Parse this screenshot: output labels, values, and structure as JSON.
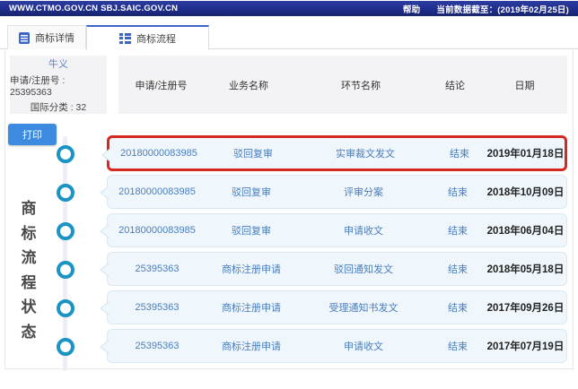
{
  "topbar": {
    "site": "WWW.CTMO.GOV.CN SBJ.SAIC.GOV.CN",
    "help": "帮助",
    "data_cutoff": "当前数据截至：(2019年02月25日)"
  },
  "tabs": [
    {
      "label": "商标详情",
      "active": false
    },
    {
      "label": "商标流程",
      "active": true
    }
  ],
  "info": {
    "name": "牛义",
    "reg_no": "申请/注册号 : 25395363",
    "intl_class": "国际分类 : 32"
  },
  "print_button": "打印",
  "vertical_title": "商标流程状态",
  "table": {
    "headers": [
      "申请/注册号",
      "业务名称",
      "环节名称",
      "结论",
      "日期"
    ],
    "rows": [
      {
        "reg_no": "20180000083985",
        "business": "驳回复审",
        "step": "实审裁文发文",
        "conclusion": "结束",
        "date": "2019年01月18日",
        "highlighted": true
      },
      {
        "reg_no": "20180000083985",
        "business": "驳回复审",
        "step": "评审分案",
        "conclusion": "结束",
        "date": "2018年10月09日",
        "highlighted": false
      },
      {
        "reg_no": "20180000083985",
        "business": "驳回复审",
        "step": "申请收文",
        "conclusion": "结束",
        "date": "2018年06月04日",
        "highlighted": false
      },
      {
        "reg_no": "25395363",
        "business": "商标注册申请",
        "step": "驳回通知发文",
        "conclusion": "结束",
        "date": "2018年05月18日",
        "highlighted": false
      },
      {
        "reg_no": "25395363",
        "business": "商标注册申请",
        "step": "受理通知书发文",
        "conclusion": "结束",
        "date": "2017年09月26日",
        "highlighted": false
      },
      {
        "reg_no": "25395363",
        "business": "商标注册申请",
        "step": "申请收文",
        "conclusion": "结束",
        "date": "2017年07月19日",
        "highlighted": false
      }
    ]
  },
  "colors": {
    "topbar_bg": "#1f2d8c",
    "tab_accent": "#3a65c9",
    "link_blue": "#4a7dbd",
    "circle_blue": "#1a93c5",
    "print_btn": "#3d8be0",
    "highlight_red": "#d5281e",
    "bubble_bg": "#eff7fc",
    "bubble_border": "#d9e9f2",
    "header_bg": "#f3f3f5"
  }
}
